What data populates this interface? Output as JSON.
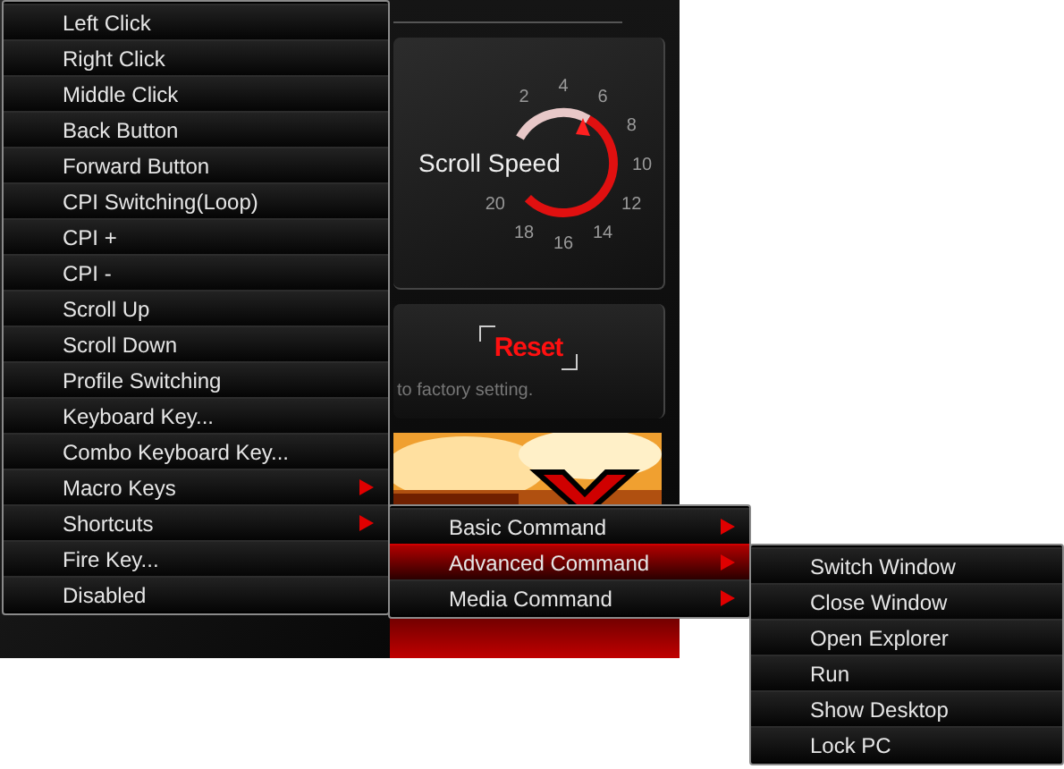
{
  "dial": {
    "label": "Scroll Speed",
    "ticks": [
      "2",
      "4",
      "6",
      "8",
      "10",
      "12",
      "14",
      "16",
      "18",
      "20"
    ]
  },
  "reset": {
    "label": "Reset",
    "note": "to factory setting."
  },
  "context_menu": {
    "items": [
      {
        "label": "Left Click",
        "has_submenu": false,
        "selected": false
      },
      {
        "label": "Right Click",
        "has_submenu": false,
        "selected": false
      },
      {
        "label": "Middle Click",
        "has_submenu": false,
        "selected": false
      },
      {
        "label": "Back Button",
        "has_submenu": false,
        "selected": false
      },
      {
        "label": "Forward Button",
        "has_submenu": false,
        "selected": false
      },
      {
        "label": "CPI Switching(Loop)",
        "has_submenu": false,
        "selected": false
      },
      {
        "label": "CPI +",
        "has_submenu": false,
        "selected": false
      },
      {
        "label": "CPI -",
        "has_submenu": false,
        "selected": false
      },
      {
        "label": "Scroll Up",
        "has_submenu": false,
        "selected": false
      },
      {
        "label": "Scroll Down",
        "has_submenu": false,
        "selected": false
      },
      {
        "label": "Profile Switching",
        "has_submenu": false,
        "selected": false
      },
      {
        "label": "Keyboard Key...",
        "has_submenu": false,
        "selected": false
      },
      {
        "label": "Combo Keyboard Key...",
        "has_submenu": false,
        "selected": false
      },
      {
        "label": "Macro Keys",
        "has_submenu": true,
        "selected": false
      },
      {
        "label": "Shortcuts",
        "has_submenu": true,
        "selected": false
      },
      {
        "label": "Fire Key...",
        "has_submenu": false,
        "selected": false
      },
      {
        "label": "Disabled",
        "has_submenu": false,
        "selected": false
      }
    ]
  },
  "shortcuts_submenu": {
    "items": [
      {
        "label": "Basic Command",
        "has_submenu": true,
        "selected": false
      },
      {
        "label": "Advanced Command",
        "has_submenu": true,
        "selected": true
      },
      {
        "label": "Media Command",
        "has_submenu": true,
        "selected": false
      }
    ]
  },
  "advanced_submenu": {
    "items": [
      {
        "label": "Switch Window",
        "has_submenu": false,
        "selected": false
      },
      {
        "label": "Close Window",
        "has_submenu": false,
        "selected": false
      },
      {
        "label": "Open Explorer",
        "has_submenu": false,
        "selected": false
      },
      {
        "label": "Run",
        "has_submenu": false,
        "selected": false
      },
      {
        "label": "Show Desktop",
        "has_submenu": false,
        "selected": false
      },
      {
        "label": "Lock PC",
        "has_submenu": false,
        "selected": false
      }
    ]
  }
}
